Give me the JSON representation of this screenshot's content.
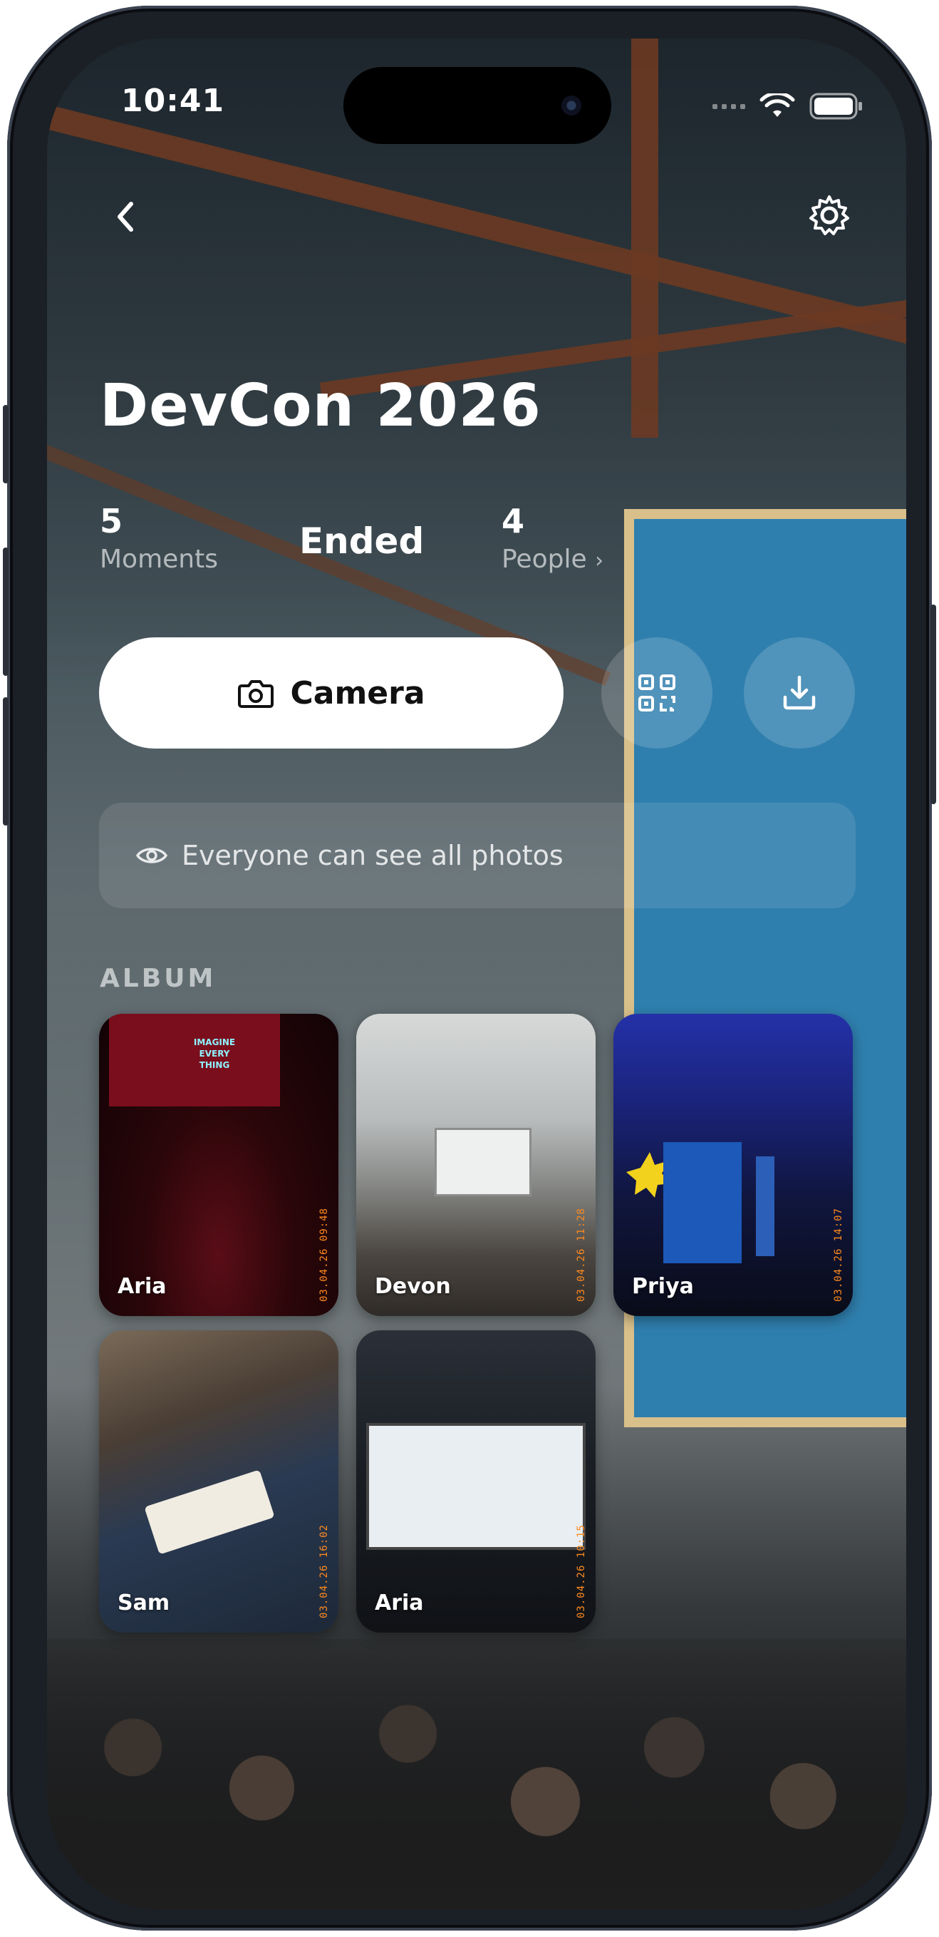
{
  "status_bar": {
    "time": "10:41"
  },
  "event": {
    "title": "DevCon 2026",
    "status": "Ended"
  },
  "stats": {
    "moments": {
      "count": "5",
      "label": "Moments"
    },
    "people": {
      "count": "4",
      "label": "People",
      "chevron": "›"
    }
  },
  "actions": {
    "camera_label": "Camera",
    "qr_icon": "qr-code-icon",
    "download_icon": "download-icon"
  },
  "visibility": {
    "text": "Everyone can see all photos",
    "icon": "eye-icon"
  },
  "album": {
    "label": "ALBUM",
    "photos": [
      {
        "author": "Aria",
        "stamp": "03.04.26  09:48"
      },
      {
        "author": "Devon",
        "stamp": "03.04.26  11:28"
      },
      {
        "author": "Priya",
        "stamp": "03.04.26  14:07"
      },
      {
        "author": "Sam",
        "stamp": "03.04.26  16:02"
      },
      {
        "author": "Aria",
        "stamp": "03.04.26  10:15"
      }
    ],
    "stage_sign": "IMAGINE EVERY THING"
  },
  "colors": {
    "accent_white": "#ffffff",
    "stamp_orange": "#ff8a1f",
    "panel_blue": "#2f7fae"
  }
}
